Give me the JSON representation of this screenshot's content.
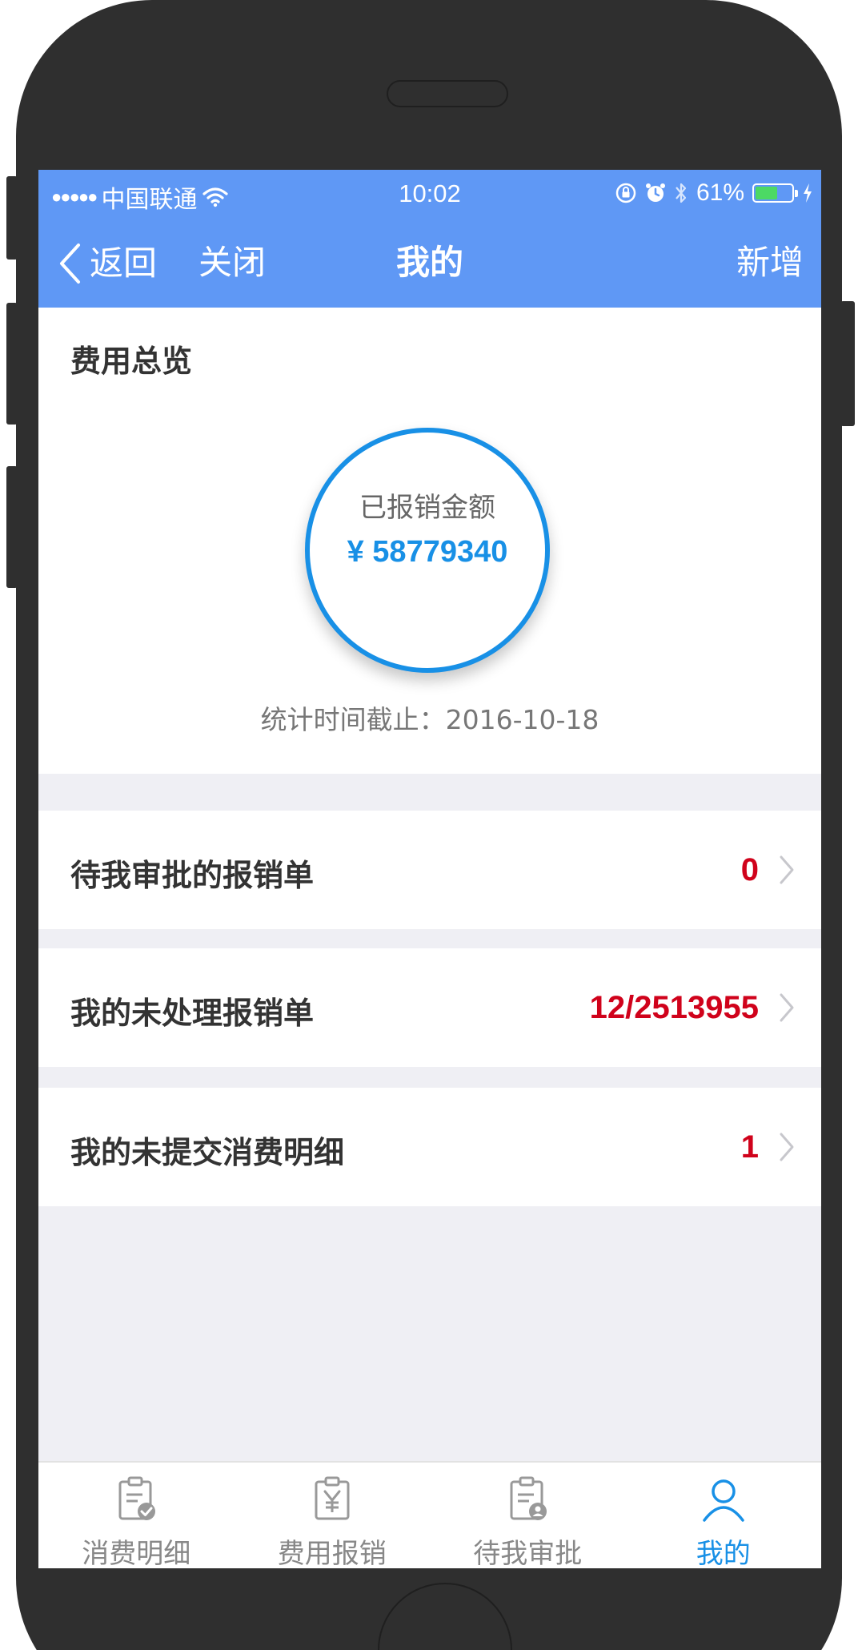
{
  "status_bar": {
    "carrier": "中国联通",
    "time": "10:02",
    "battery_percent": "61%",
    "battery_level": 0.61,
    "signal_icon": "signal-dots-icon",
    "wifi_icon": "wifi-icon",
    "battery_fill_color": "#4cd964"
  },
  "nav": {
    "back_label": "返回",
    "close_label": "关闭",
    "title": "我的",
    "add_label": "新增",
    "background_color": "#5f98f5"
  },
  "overview": {
    "title": "费用总览",
    "circle_label": "已报销金额",
    "amount": "¥ 58779340",
    "stat_time": "统计时间截止：2016-10-18",
    "accent_color": "#1890e6"
  },
  "rows": [
    {
      "label": "待我审批的报销单",
      "value": "0"
    },
    {
      "label": "我的未处理报销单",
      "value": "12/2513955"
    },
    {
      "label": "我的未提交消费明细",
      "value": "1"
    }
  ],
  "tabs": [
    {
      "label": "消费明细",
      "icon": "clipboard-check-icon",
      "active": false
    },
    {
      "label": "费用报销",
      "icon": "clipboard-yen-icon",
      "active": false
    },
    {
      "label": "待我审批",
      "icon": "clipboard-user-icon",
      "active": false
    },
    {
      "label": "我的",
      "icon": "person-icon",
      "active": true
    }
  ],
  "colors": {
    "value_red": "#d0021b",
    "tab_inactive": "#888888",
    "tab_active": "#1890e6"
  }
}
